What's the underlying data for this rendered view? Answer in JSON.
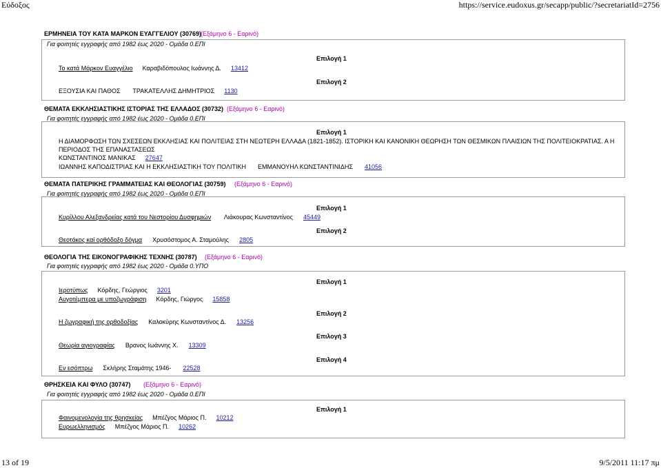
{
  "header": {
    "title": "Εύδοξος",
    "url": "https://service.eudoxus.gr/secapp/public/?secretariatId=2756"
  },
  "footer": {
    "page": "13 of 19",
    "datetime": "9/5/2011 11:17 πμ"
  },
  "courses": [
    {
      "title": "ΕΡΜΗΝΕΙΑ ΤΟΥ ΚΑΤΑ ΜΑΡΚΟΝ ΕΥΑΓΓΕΛΙΟΥ (30769)",
      "semester": "(Εξάμηνο 6 - Εαρινό)",
      "note": "Για φοιτητές εγγραφής από 1982 έως 2020 - Ομάδα 0.ΕΠΙ",
      "choices": [
        {
          "label": "Επιλογή 1",
          "books": [
            {
              "title": "Το κατά Μάρκον Ευαγγέλιο",
              "author": "Καραβιδόπουλος Ιωάννης Δ.",
              "code": "13412"
            }
          ]
        },
        {
          "label": "Επιλογή 2",
          "books": [
            {
              "title": "ΕΞΟΥΣΙΑ ΚΑΙ ΠΑΘΟΣ",
              "author": "ΤΡΑΚΑΤΕΛΛΗΣ ΔΗΜΗΤΡΙΟΣ",
              "code": "1130"
            }
          ]
        }
      ]
    },
    {
      "title": "ΘΕΜΑΤΑ ΕΚΚΛΗΣΙΑΣΤΙΚΗΣ ΙΣΤΟΡΙΑΣ ΤΗΣ ΕΛΛΑΔΟΣ (30732)",
      "semester": "(Εξάμηνο 6 - Εαρινό)",
      "note": "Για φοιτητές εγγραφής από 1982 έως 2020 - Ομάδα 0.ΕΠΙ",
      "choices": [
        {
          "label": "Επιλογή 1",
          "books": [
            {
              "title": "Η ΔΙΑΜΟΡΦΩΣΗ ΤΩΝ ΣΧΕΣΕΩΝ ΕΚΚΛΗΣΙΑΣ ΚΑΙ ΠΟΛΙΤΕΙΑΣ ΣΤΗ ΝΕΩΤΕΡΗ ΕΛΛΑΔΑ (1821-1852). ΙΣΤΟΡΙΚΗ ΚΑΙ ΚΑΝΟΝΙΚΗ ΘΕΩΡΗΣΗ ΤΩΝ ΘΕΣΜΙΚΩΝ ΠΛΑΙΣΙΩΝ ΤΗΣ ΠΟΛΙΤΕΙΟΚΡΑΤΙΑΣ. Α Η",
              "title2": "ΠΕΡΙΟΔΟΣ ΤΗΣ ΕΠΑΝΑΣΤΑΣΕΩΣ",
              "author": "ΚΩΝΣΤΑΝΤΙΝΟΣ ΜΑΝΙΚΑΣ",
              "code": "27647"
            },
            {
              "title": "ΙΩΑΝΝΗΣ ΚΑΠΟΔΙΣΤΡΙΑΣ ΚΑΙ Η ΕΚΚΛΗΣΙΑΣΤΙΚΗ ΤΟΥ ΠΟΛΙΤΙΚΗ",
              "author": "ΕΜΜΑΝΟΥΗΛ ΚΩΝΣΤΑΝΤΙΝΙΔΗΣ",
              "code": "41056"
            }
          ]
        }
      ]
    },
    {
      "title": "ΘΕΜΑΤΑ ΠΑΤΕΡΙΚΗΣ ΓΡΑΜΜΑΤΕΙΑΣ ΚΑΙ ΘΕΟΛΟΓΙΑΣ (30759)",
      "semester": "(Εξάμηνο 6 - Εαρινό)",
      "note": "Για φοιτητές εγγραφής από 1982 έως 2020 - Ομάδα 0.ΕΠΙ",
      "choices": [
        {
          "label": "Επιλογή 1",
          "books": [
            {
              "title": "Κυρίλλου Αλεξανδρείας κατά του Νεστορίου Δυσφημιών",
              "author": "Λιάκουρας Κωνσταντίνος",
              "code": "45449"
            }
          ]
        },
        {
          "label": "Επιλογή 2",
          "books": [
            {
              "title": "Θεοτόκος καί ορθόδοξο δόγμα",
              "author": "Χρυσόστομος Α. Σταμούλης",
              "code": "2805"
            }
          ]
        }
      ]
    },
    {
      "title": "ΘΕΟΛΟΓΙΑ ΤΗΣ ΕΙΚΟΝΟΓΡΑΦΙΚΗΣ ΤΕΧΝΗΣ (30787)",
      "semester": "(Εξάμηνο 6 - Εαρινό)",
      "note": "Για φοιτητές εγγραφής από 1982 έως 2020 - Ομάδα 0.ΥΠΟ",
      "choices": [
        {
          "label": "Επιλογή 1",
          "books": [
            {
              "title": "Ιεροτύπως",
              "author": "Κόρδης, Γεώργιος",
              "code": "3201"
            },
            {
              "title": "Αυγοτέμπερα με υποζωγράφιση",
              "author": "Κόρδης, Γιώργος",
              "code": "15858"
            }
          ]
        },
        {
          "label": "Επιλογή 2",
          "books": [
            {
              "title": "Η ζωγραφική της ορθοδοξίας",
              "author": "Καλοκύρης Κωνσταντίνος Δ.",
              "code": "13256"
            }
          ]
        },
        {
          "label": "Επιλογή 3",
          "books": [
            {
              "title": "Θεωρία αγιογραφίας",
              "author": "Βρανος Ιωάννης Χ.",
              "code": "13309"
            }
          ]
        },
        {
          "label": "Επιλογή 4",
          "books": [
            {
              "title": "Εν εσόπτρω",
              "author": "Σκλήρης Σταμάτης 1946-",
              "code": "22528"
            }
          ]
        }
      ]
    },
    {
      "title": "ΘΡΗΣΚΕΙΑ ΚΑΙ ΦΥΛΟ (30747)",
      "semester": "(Εξάμηνο 6 - Εαρινό)",
      "note": "Για φοιτητές εγγραφής από 1982 έως 2020 - Ομάδα 0.ΕΠΙ",
      "choices": [
        {
          "label": "Επιλογή 1",
          "books": [
            {
              "title": "Φαινομενολογία της θρησκείας",
              "author": "Μπέζγος Μάριος Π.",
              "code": "10212"
            },
            {
              "title": "Ευρωελληνισμός",
              "author": "Μπέζγος Μάριος Π.",
              "code": "10262"
            }
          ]
        }
      ]
    }
  ]
}
